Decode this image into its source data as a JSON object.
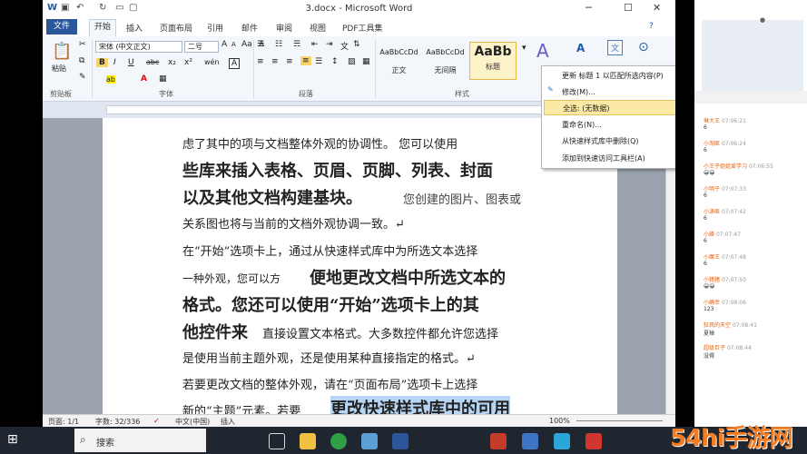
{
  "titlebar": {
    "title": "3.docx - Microsoft Word",
    "minimize": "─",
    "maximize": "☐",
    "close": "✕"
  },
  "tabs": {
    "file": "文件",
    "home": "开始",
    "insert": "插入",
    "layout": "页面布局",
    "references": "引用",
    "mailings": "邮件",
    "review": "审阅",
    "view": "视图",
    "pdf": "PDF工具集"
  },
  "clipboard": {
    "paste": "粘贴",
    "label": "剪贴板"
  },
  "font": {
    "name": "宋体 (中文正文)",
    "size": "二号",
    "label": "字体",
    "bold": "B",
    "italic": "I",
    "underline": "U",
    "strike": "abc",
    "sub": "x₂",
    "sup": "x²",
    "grow": "A",
    "shrink": "A",
    "case": "Aa",
    "wen": "wén",
    "highlight": "ab",
    "color": "A",
    "clear": "A",
    "border": "A"
  },
  "paragraph": {
    "label": "段落"
  },
  "styles": {
    "label": "样式",
    "items": [
      {
        "sample": "AaBbCcDd",
        "name": "正文"
      },
      {
        "sample": "AaBbCcDd",
        "name": "无间隔"
      },
      {
        "sample": "AaBb",
        "name": "标题"
      }
    ],
    "change": "A",
    "find": "A",
    "selecttext": "文"
  },
  "edit": {
    "label": "文"
  },
  "context_menu": {
    "items": [
      "更新 标题 1 以匹配所选内容(P)",
      "修改(M)...",
      "全选: (无数据)",
      "重命名(N)...",
      "从快速样式库中删除(Q)",
      "添加到快速访问工具栏(A)"
    ]
  },
  "document": {
    "lines": [
      {
        "t": "虑了其中的项与文档整体外观的协调性。 您可以使用",
        "s": "normal"
      },
      {
        "t": "些库来插入表格、页眉、页脚、列表、封面",
        "s": "big"
      },
      {
        "t": "以及其他文档构建基块。",
        "s": "big"
      },
      {
        "t": "您创建的图片、图表或",
        "s": "normal"
      },
      {
        "t": "关系图也将与当前的文档外观协调一致。↵",
        "s": "normal"
      },
      {
        "t": "在“开始”选项卡上，通过从快速样式库中为所选文本选择",
        "s": "normal"
      },
      {
        "t": "一种外观，您可以方",
        "s": "normal"
      },
      {
        "t": "便地更改文档中所选文本的",
        "s": "big"
      },
      {
        "t": "格式。您还可以使用“开始”选项卡上的其",
        "s": "big"
      },
      {
        "t": "他控件来",
        "s": "big"
      },
      {
        "t": "直接设置文本格式。大多数控件都允许您选择",
        "s": "normal"
      },
      {
        "t": "是使用当前主题外观，还是使用某种直接指定的格式。↵",
        "s": "normal"
      },
      {
        "t": "若要更改文档的整体外观，请在“页面布局”选项卡上选择",
        "s": "normal"
      },
      {
        "t": "新的“主题”元素。若要",
        "s": "normal"
      },
      {
        "t": "更改快速样式库中的可用",
        "s": "big"
      }
    ]
  },
  "status": {
    "page": "页面: 1/1",
    "words": "字数: 32/336",
    "lang": "中文(中国)",
    "mode": "插入",
    "zoom": "100%",
    "zoom_value": 100
  },
  "sidebar": {
    "messages": [
      {
        "name": "琳大王",
        "time": "07:06:21",
        "text": "6"
      },
      {
        "name": "小淘匪",
        "time": "07:06:24",
        "text": "6"
      },
      {
        "name": "小王子姐姐爱学习",
        "time": "07:06:55",
        "text": "😀😀"
      },
      {
        "name": "小明子",
        "time": "07:07:33",
        "text": "6"
      },
      {
        "name": "小涛匪",
        "time": "07:07:42",
        "text": "6"
      },
      {
        "name": "小峰",
        "time": "07:07:47",
        "text": "6"
      },
      {
        "name": "小魔王",
        "time": "07:07:48",
        "text": "6"
      },
      {
        "name": "小猪猪",
        "time": "07:07:50",
        "text": "😀😀"
      },
      {
        "name": "小确幸",
        "time": "07:08:06",
        "text": "123"
      },
      {
        "name": "狂风的天空",
        "time": "07:08:41",
        "text": "夏禅"
      },
      {
        "name": "超级巨子",
        "time": "07:08:44",
        "text": "没得"
      }
    ]
  },
  "taskbar": {
    "search": "搜索"
  },
  "watermark": "54hi手游网"
}
